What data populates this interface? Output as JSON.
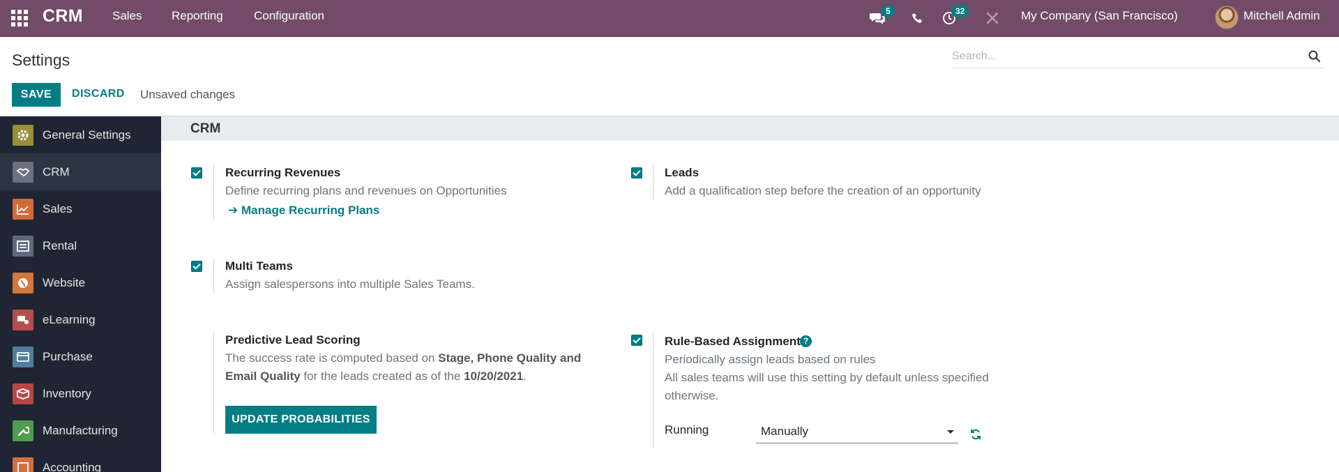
{
  "topbar": {
    "app_name": "CRM",
    "menu": [
      "Sales",
      "Reporting",
      "Configuration"
    ],
    "messages_count": "5",
    "activities_count": "32",
    "company": "My Company (San Francisco)",
    "user": "Mitchell Admin",
    "brand_color": "#714b67"
  },
  "control_panel": {
    "title": "Settings",
    "search_placeholder": "Search...",
    "save_label": "SAVE",
    "discard_label": "DISCARD",
    "status": "Unsaved changes"
  },
  "sidebar": {
    "items": [
      {
        "label": "General Settings",
        "icon": "gear-icon",
        "color": "#9a8f3c"
      },
      {
        "label": "CRM",
        "icon": "handshake-icon",
        "color": "#6c7080"
      },
      {
        "label": "Sales",
        "icon": "chart-icon",
        "color": "#d26b3a"
      },
      {
        "label": "Rental",
        "icon": "rental-icon",
        "color": "#5f6a7e"
      },
      {
        "label": "Website",
        "icon": "globe-icon",
        "color": "#d3773b"
      },
      {
        "label": "eLearning",
        "icon": "elearning-icon",
        "color": "#b94c4c"
      },
      {
        "label": "Purchase",
        "icon": "card-icon",
        "color": "#4f7ea0"
      },
      {
        "label": "Inventory",
        "icon": "box-icon",
        "color": "#b94545"
      },
      {
        "label": "Manufacturing",
        "icon": "wrench-icon",
        "color": "#4f9d50"
      },
      {
        "label": "Accounting",
        "icon": "accounting-icon",
        "color": "#cf6f42"
      }
    ]
  },
  "section": {
    "title": "CRM",
    "recurring": {
      "title": "Recurring Revenues",
      "desc": "Define recurring plans and revenues on Opportunities",
      "link": "Manage Recurring Plans",
      "checked": true
    },
    "leads": {
      "title": "Leads",
      "desc": "Add a qualification step before the creation of an opportunity",
      "checked": true
    },
    "multi_teams": {
      "title": "Multi Teams",
      "desc": "Assign salespersons into multiple Sales Teams.",
      "checked": true
    },
    "predictive": {
      "title": "Predictive Lead Scoring",
      "desc_1": "The success rate is computed based on ",
      "desc_bold_1": "Stage, Phone Quality and",
      "desc_bold_2": "Email Quality",
      "desc_2": " for the leads created as of the ",
      "desc_date": "10/20/2021",
      "desc_end": ".",
      "button": "UPDATE PROBABILITIES"
    },
    "rule_based": {
      "title": "Rule-Based Assignment",
      "desc_1": "Periodically assign leads based on rules",
      "desc_2": "All sales teams will use this setting by default unless specified",
      "desc_3": "otherwise.",
      "running_label": "Running",
      "running_value": "Manually",
      "checked": true
    }
  }
}
